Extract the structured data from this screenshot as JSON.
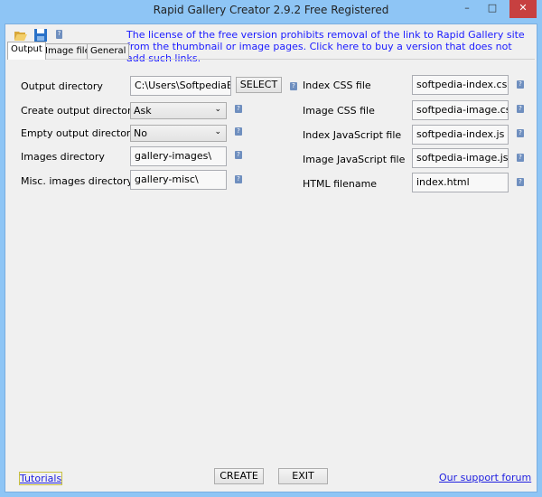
{
  "window": {
    "title": "Rapid Gallery Creator 2.9.2 Free Registered",
    "minimize": "–",
    "maximize": "□",
    "close": "✕"
  },
  "toolbar": {
    "icons": [
      "folder-open-icon",
      "save-icon",
      "help-icon"
    ],
    "notice": "The license of the free version prohibits removal of the link to Rapid Gallery site from the thumbnail or image pages. Click here to buy a version that does not add such links."
  },
  "tabs": [
    {
      "label": "Output",
      "active": true
    },
    {
      "label": "Image files"
    },
    {
      "label": "General"
    }
  ],
  "left": {
    "output_directory": {
      "label": "Output directory",
      "value": "C:\\Users\\SoftpediaE",
      "button": "SELECT"
    },
    "create_output_directory": {
      "label": "Create output directory",
      "value": "Ask"
    },
    "empty_output_directory": {
      "label": "Empty output directory",
      "value": "No"
    },
    "images_directory": {
      "label": "Images directory",
      "value": "gallery-images\\"
    },
    "misc_images_directory": {
      "label": "Misc. images directory",
      "value": "gallery-misc\\"
    }
  },
  "right": [
    {
      "label": "Index CSS file",
      "value": "softpedia-index.css"
    },
    {
      "label": "Image CSS file",
      "value": "softpedia-image.css"
    },
    {
      "label": "Index JavaScript file",
      "value": "softpedia-index.js"
    },
    {
      "label": "Image JavaScript file",
      "value": "softpedia-image.js"
    },
    {
      "label": "HTML filename",
      "value": "index.html"
    }
  ],
  "help_glyph": "?",
  "footer": {
    "tutorials": "Tutorials",
    "create": "CREATE",
    "exit": "EXIT",
    "forum": "Our support forum"
  }
}
